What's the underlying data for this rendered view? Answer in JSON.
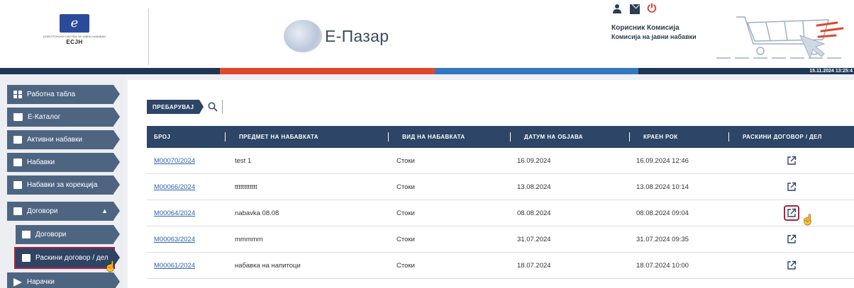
{
  "header": {
    "logo": {
      "emblem": "e",
      "small_text": "ЕЛЕКТРОНСКИ СИСТЕМ ЗА ЈАВНИ НАБАВКИ",
      "short_name": "ЕСЈН"
    },
    "brand": "Е-Пазар",
    "user": {
      "name": "Корисник Комисија",
      "organization": "Комисија на јавни набавки"
    },
    "icons": [
      "user-icon",
      "mail-icon",
      "power-icon"
    ],
    "timestamp": "15.11.2024 13:25:4"
  },
  "colors": {
    "navy": "#1f3757",
    "red": "#e2472b",
    "blue": "#3178c1",
    "sidebar_item": "#4e6582",
    "table_header": "#2d4566",
    "link": "#2c64b4",
    "highlight": "#b02040"
  },
  "sidebar": {
    "items": [
      {
        "label": "Работна табла",
        "icon": "dashboard-icon"
      },
      {
        "label": "Е-Каталог",
        "icon": "cart-icon"
      },
      {
        "label": "Активни набавки",
        "icon": "document-icon"
      },
      {
        "label": "Набавки",
        "icon": "list-icon"
      },
      {
        "label": "Набавки за корекција",
        "icon": "edit-list-icon"
      },
      {
        "label": "Договори",
        "icon": "contract-icon",
        "expanded": true
      },
      {
        "label": "Договори",
        "icon": "document-icon"
      },
      {
        "label": "Раскини договор / дел",
        "icon": "terminate-icon",
        "active": true
      },
      {
        "label": "Нарачки",
        "icon": "arrow-icon"
      }
    ]
  },
  "search": {
    "label": "ПРЕБАРУВАЈ"
  },
  "table": {
    "columns": [
      "БРОЈ",
      "ПРЕДМЕТ НА НАБАВКАТА",
      "ВИД НА НАБАВКАТА",
      "ДАТУМ НА ОБЈАВА",
      "КРАЕН РОК",
      "РАСКИНИ ДОГОВОР / ДЕЛ"
    ],
    "rows": [
      {
        "number": "M00070/2024",
        "subject": "test 1",
        "type": "Стоки",
        "published": "16.09.2024",
        "deadline": "16.09.2024 12:46"
      },
      {
        "number": "M00066/2024",
        "subject": "tttttttttttt",
        "type": "Стоки",
        "published": "13.08.2024",
        "deadline": "13.08.2024 10:14"
      },
      {
        "number": "M00064/2024",
        "subject": "nabavka 08.08",
        "type": "Стоки",
        "published": "08.08.2024",
        "deadline": "08.08.2024 09:04"
      },
      {
        "number": "M00063/2024",
        "subject": "mmmmm",
        "type": "Стоки",
        "published": "31.07.2024",
        "deadline": "31.07.2024 09:35"
      },
      {
        "number": "M00061/2024",
        "subject": "набавка на напитоци",
        "type": "Стоки",
        "published": "18.07.2024",
        "deadline": "18.07.2024 10:00"
      }
    ]
  }
}
